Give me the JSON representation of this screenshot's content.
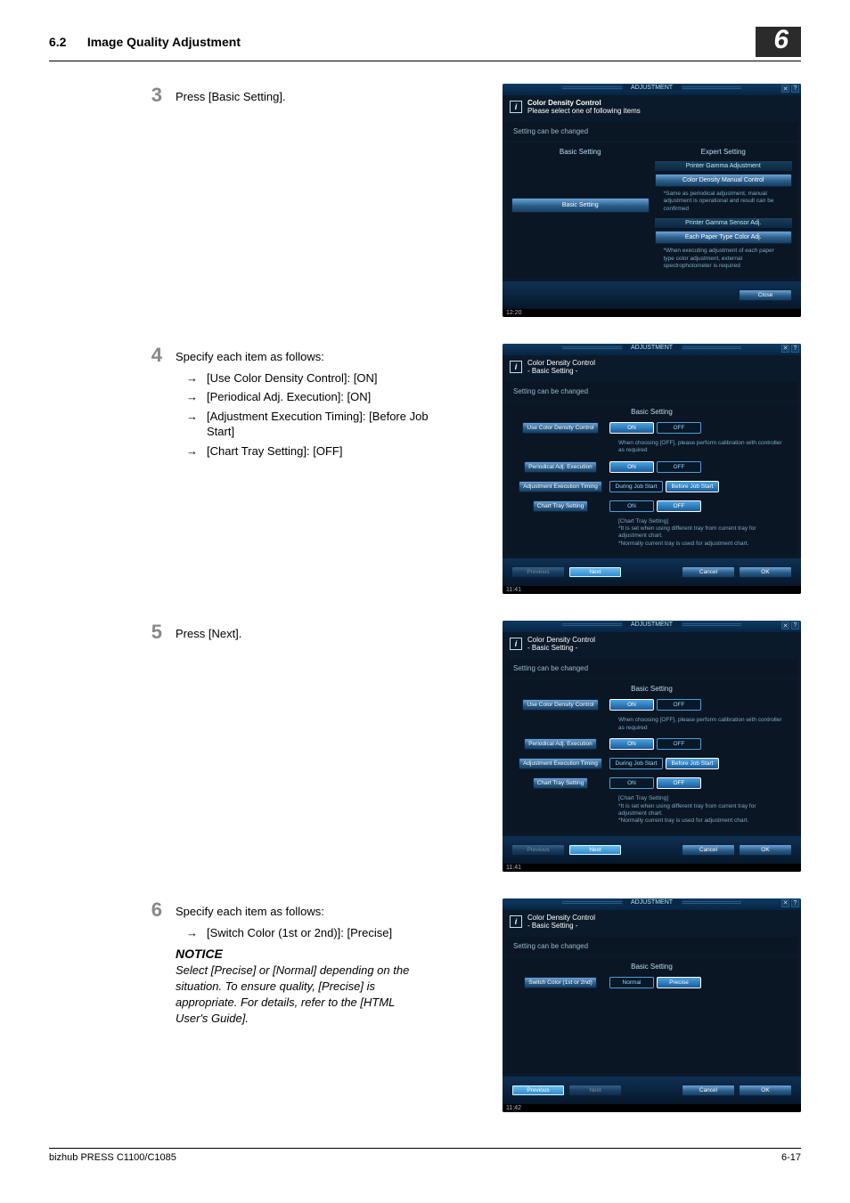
{
  "header": {
    "section": "6.2",
    "title": "Image Quality Adjustment",
    "chapter": "6"
  },
  "steps": {
    "3": {
      "num": "3",
      "text": "Press [Basic Setting]."
    },
    "4": {
      "num": "4",
      "text": "Specify each item as follows:",
      "items": [
        "[Use Color Density Control]: [ON]",
        "[Periodical Adj. Execution]: [ON]",
        "[Adjustment Execution Timing]: [Before Job Start]",
        "[Chart Tray Setting]: [OFF]"
      ]
    },
    "5": {
      "num": "5",
      "text": "Press [Next]."
    },
    "6": {
      "num": "6",
      "text": "Specify each item as follows:",
      "items": [
        "[Switch Color (1st or 2nd)]: [Precise]"
      ],
      "notice_label": "NOTICE",
      "notice_body": "Select [Precise] or [Normal] depending on the situation. To ensure quality, [Precise] is appropriate. For details, refer to the [HTML User's Guide]."
    }
  },
  "scr": {
    "adj": "ADJUSTMENT",
    "icon_close": "✕",
    "icon_help": "?",
    "title3_l1": "Color Density Control",
    "title3_l2": "Please select one of following items",
    "settingChanged": "Setting can be changed",
    "basicSettingHdr": "Basic Setting",
    "expertSettingHdr": "Expert Setting",
    "basicSettingBtn": "Basic Setting",
    "printerGammaAdj": "Printer Gamma Adjustment",
    "cdmc": "Color Density Manual Control",
    "desc3a": "*Same as periodical adjustment, manual adjustment is operational and result can be confirmed",
    "printerGammaSensor": "Printer Gamma Sensor Adj.",
    "eachPaperType": "Each Paper Type Color Adj.",
    "desc3b": "*When executing adjustment of each paper type color adjustment, external spectrophotometer is required",
    "closeBtn": "Close",
    "time3": "12:20",
    "title4": "Color Density Control\n- Basic Setting -",
    "r1": "Use Color Density Control",
    "r2": "Periodical Adj. Execution",
    "r3": "Adjustment Execution Timing",
    "r4": "Chart Tray Setting",
    "on": "ON",
    "off": "OFF",
    "duringJob": "During Job Start",
    "beforeJob": "Before Job Start",
    "desc4a": "When choosing [OFF], please perform calibration with controller as required",
    "desc4b": "[Chart Tray Setting]\n*It is set when using different tray from current tray for adjustment chart.\n*Normally current tray is used for adjustment chart.",
    "previous": "Previous",
    "next": "Next",
    "cancel": "Cancel",
    "ok": "OK",
    "time4": "11:41",
    "time5": "11:41",
    "r6": "Switch Color (1st or 2nd)",
    "normal": "Normal",
    "precise": "Precise",
    "time6": "11:42"
  },
  "footer": {
    "left": "bizhub PRESS C1100/C1085",
    "right": "6-17"
  }
}
